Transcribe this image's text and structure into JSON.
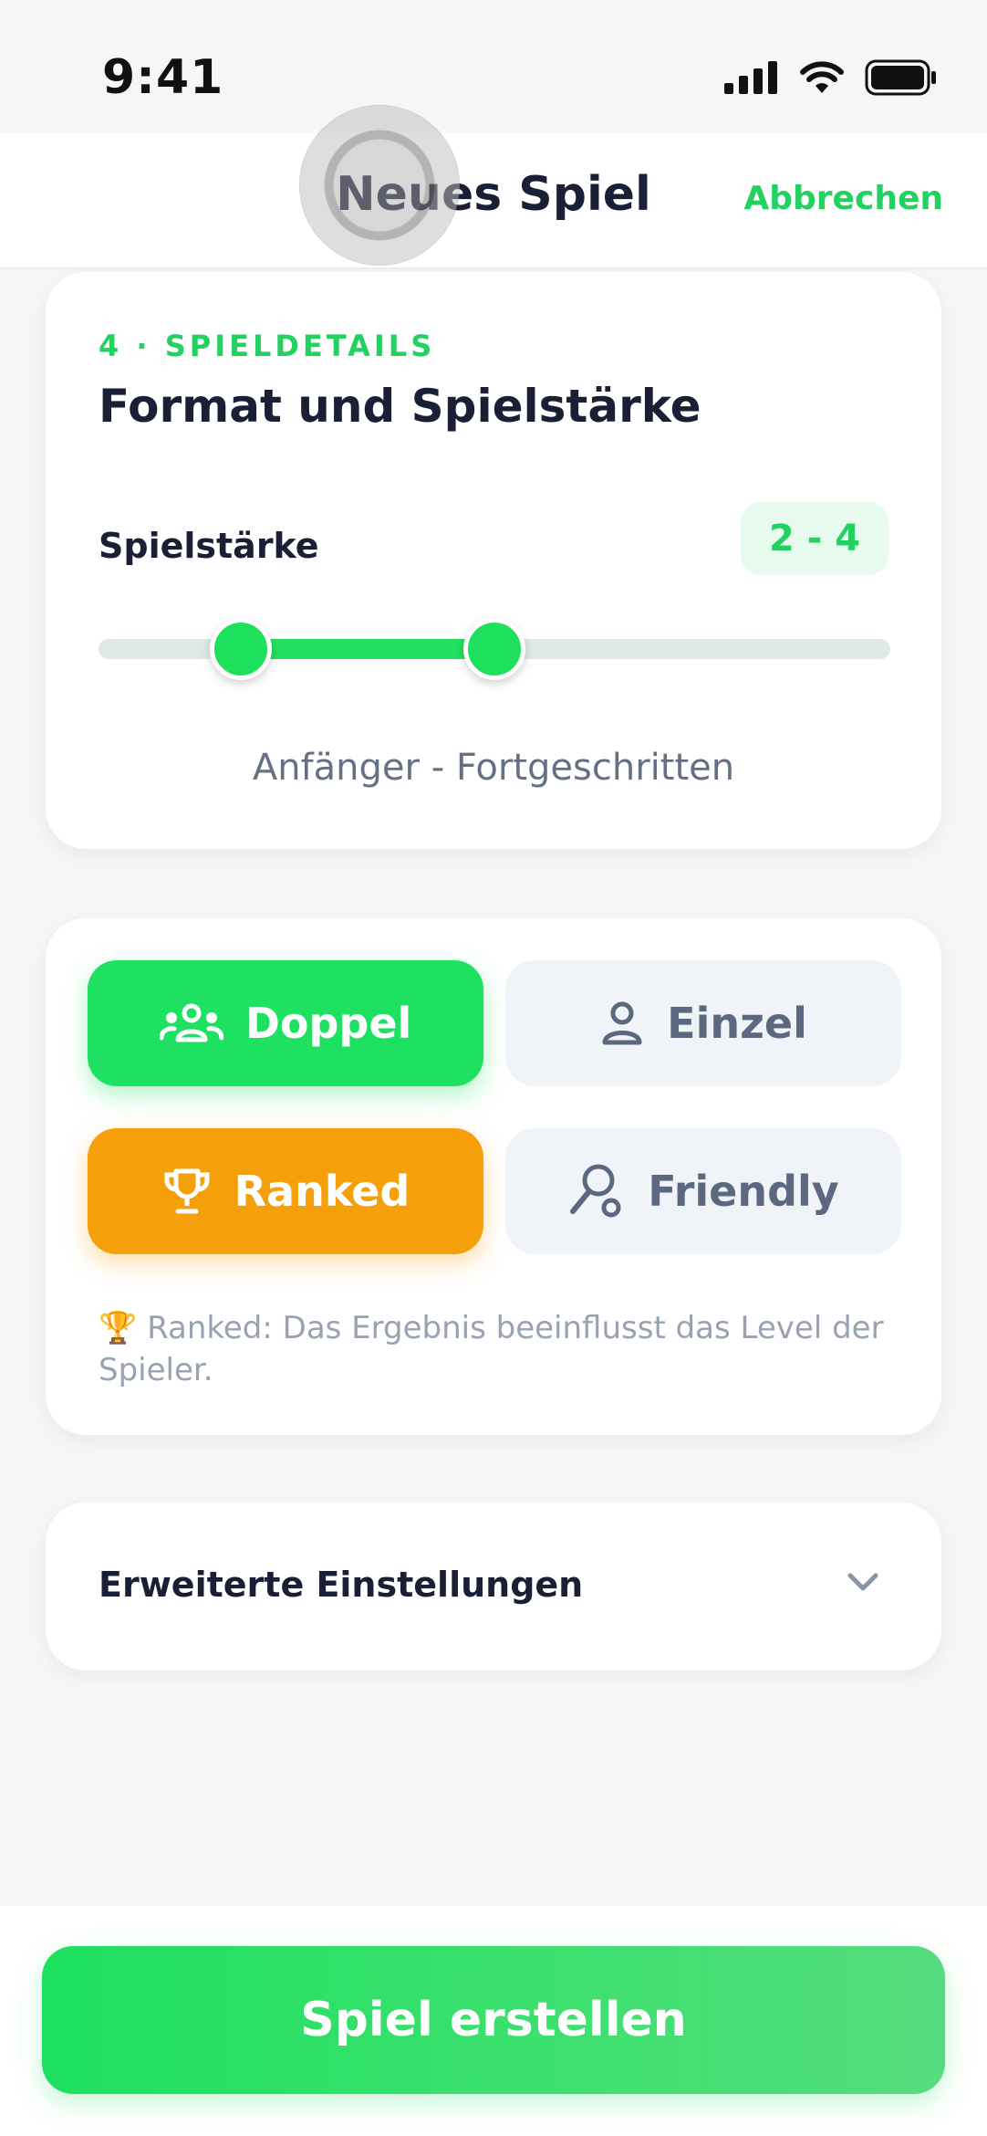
{
  "status_bar": {
    "time": "9:41"
  },
  "header": {
    "title": "Neues Spiel",
    "cancel_label": "Abbrechen"
  },
  "details": {
    "step_label": "4 · SPIELDETAILS",
    "heading": "Format und Spielstärke",
    "skill_label": "Spielstärke",
    "skill_badge": "2 - 4",
    "skill_range_text": "Anfänger - Fortgeschritten",
    "slider": {
      "low_fraction": 0.18,
      "high_fraction": 0.5
    }
  },
  "format": {
    "doppel_label": "Doppel",
    "einzel_label": "Einzel",
    "ranked_label": "Ranked",
    "friendly_label": "Friendly",
    "doppel_selected": true,
    "ranked_selected": true,
    "note": "🏆 Ranked: Das Ergebnis beeinflusst das Level der Spieler."
  },
  "advanced": {
    "label": "Erweiterte Einstellungen"
  },
  "footer": {
    "create_label": "Spiel erstellen"
  },
  "colors": {
    "accent": "#22d160",
    "ranked": "#f59f0a",
    "text": "#1a1f36",
    "muted": "#667085"
  }
}
